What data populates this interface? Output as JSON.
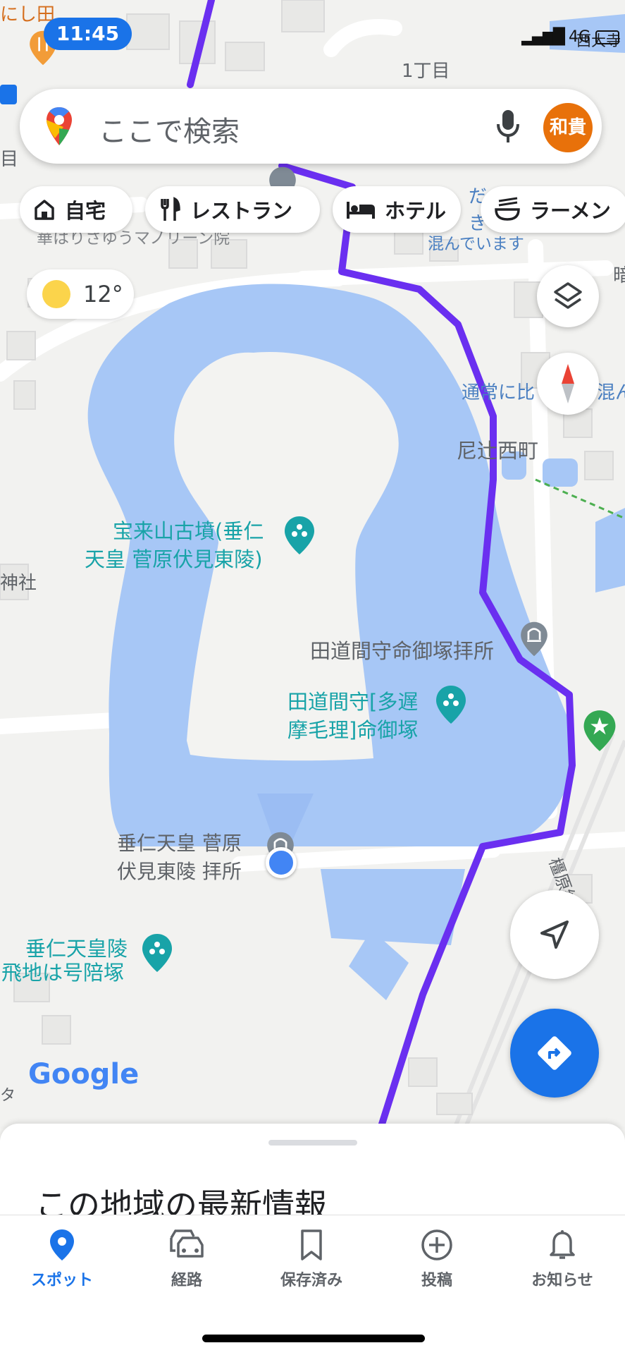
{
  "status_bar": {
    "time": "11:45",
    "network": "4G"
  },
  "search": {
    "placeholder": "ここで検索",
    "avatar_text": "和貴"
  },
  "chips": [
    {
      "label": "自宅",
      "icon": "home-icon"
    },
    {
      "label": "レストラン",
      "icon": "restaurant-icon"
    },
    {
      "label": "ホテル",
      "icon": "hotel-icon"
    },
    {
      "label": "ラーメン",
      "icon": "ramen-icon"
    }
  ],
  "weather": {
    "temp": "12°",
    "icon": "sun-icon"
  },
  "map": {
    "labels": {
      "top_left": "にし田",
      "chome": "1丁目",
      "top_right": "西大寺",
      "crowd_top": "だ",
      "crowd_ki": "き",
      "crowd_note": "混んでいます",
      "crowded_top_right": "通常に比",
      "crowded_suffix": "混ん",
      "town": "尼辻西町",
      "left_shrine": "神社",
      "left_edge": "目",
      "temple_partial": "華はりさゆうマノリーン院",
      "kofun_line1": "宝来山古墳(垂仁",
      "kofun_line2": "天皇 菅原伏見東陵)",
      "tajima_worship": "田道間守命御塚拝所",
      "tajima_line1": "田道間守[多遅",
      "tajima_line2": "摩毛理]命御塚",
      "suinin_line1": "垂仁天皇 菅原",
      "suinin_line2": "伏見東陵 拝所",
      "haibaizuka_line1": "垂仁天皇陵",
      "haibaizuka_line2": "飛地は号陪塚",
      "railway": "橿原線",
      "bottom_left": "タ",
      "right_edge": "暗",
      "google": "Google"
    },
    "colors": {
      "water": "#a7c7f6",
      "route": "#6a2ff0",
      "poi": "#18a3a8"
    }
  },
  "sheet": {
    "title": "この地域の最新情報"
  },
  "nav": [
    {
      "label": "スポット",
      "icon": "place-pin-icon",
      "active": true
    },
    {
      "label": "経路",
      "icon": "car-icon",
      "active": false
    },
    {
      "label": "保存済み",
      "icon": "bookmark-icon",
      "active": false
    },
    {
      "label": "投稿",
      "icon": "add-circle-icon",
      "active": false
    },
    {
      "label": "お知らせ",
      "icon": "bell-icon",
      "active": false
    }
  ]
}
